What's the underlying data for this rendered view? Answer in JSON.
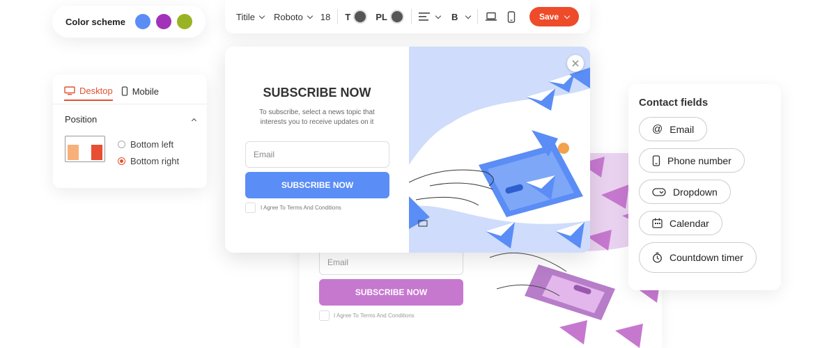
{
  "color_scheme": {
    "label": "Color scheme",
    "swatches": [
      "#5a8df5",
      "#a232b8",
      "#98b424"
    ]
  },
  "toolbar": {
    "heading_select": "Titile",
    "font_select": "Roboto",
    "font_size": "18",
    "text_color_label": "T",
    "placeholder_color_label": "PL",
    "bold_label": "B",
    "save_label": "Save"
  },
  "device": {
    "tabs": [
      {
        "label": "Desktop",
        "active": true
      },
      {
        "label": "Mobile",
        "active": false
      }
    ],
    "position_label": "Position",
    "options": [
      {
        "label": "Bottom left",
        "selected": false
      },
      {
        "label": "Bottom right",
        "selected": true
      }
    ]
  },
  "popup": {
    "title": "SUBSCRIBE NOW",
    "description": "To subscribe, select a news topic that interests you to receive updates on it",
    "email_placeholder": "Email",
    "button_label": "SUBSCRIBE NOW",
    "agree_label": "I Agree To Terms And Conditions",
    "accent_color": "#5a8df5"
  },
  "back_popup": {
    "email_placeholder": "Email",
    "button_label": "SUBSCRIBE NOW",
    "agree_label": "I Agree To Terms And Conditions",
    "accent_color": "#c678cf"
  },
  "contact_fields": {
    "title": "Contact fields",
    "items": [
      {
        "label": "Email",
        "icon": "at-icon"
      },
      {
        "label": "Phone number",
        "icon": "phone-icon"
      },
      {
        "label": "Dropdown",
        "icon": "dropdown-icon"
      },
      {
        "label": "Calendar",
        "icon": "calendar-icon"
      },
      {
        "label": "Countdown timer",
        "icon": "timer-icon"
      }
    ]
  }
}
